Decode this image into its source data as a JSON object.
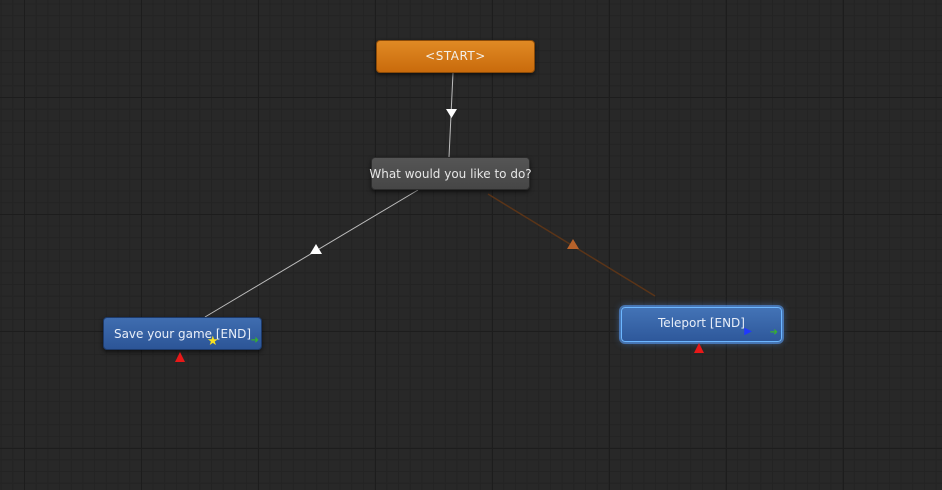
{
  "graph": {
    "nodes": {
      "start": {
        "label": "<START>",
        "kind": "start"
      },
      "question": {
        "label": "What would you like to do?",
        "kind": "choice"
      },
      "save": {
        "label": "Save your game [END]",
        "kind": "end",
        "icons": [
          "star-icon",
          "out-arrow-icon",
          "input-marker-icon"
        ]
      },
      "teleport": {
        "label": "Teleport [END]",
        "kind": "end",
        "selected": true,
        "icons": [
          "play-icon",
          "out-arrow-icon",
          "input-marker-icon"
        ]
      }
    },
    "connections": [
      {
        "from": "start",
        "to": "question",
        "color": "#c8c8c8"
      },
      {
        "from": "question",
        "to": "save",
        "color": "#c8c8c8"
      },
      {
        "from": "question",
        "to": "teleport",
        "color": "#5a3418",
        "arrow_color": "#b8622a"
      }
    ]
  },
  "colors": {
    "background": "#282828",
    "start_node": "#d97b18",
    "choice_node": "#4e4e4e",
    "end_node": "#3661a4",
    "selection_glow": "#5aa0ff",
    "input_marker": "#e81818",
    "star": "#f6e020",
    "output_arrow": "#38b030",
    "play": "#2038ff"
  }
}
